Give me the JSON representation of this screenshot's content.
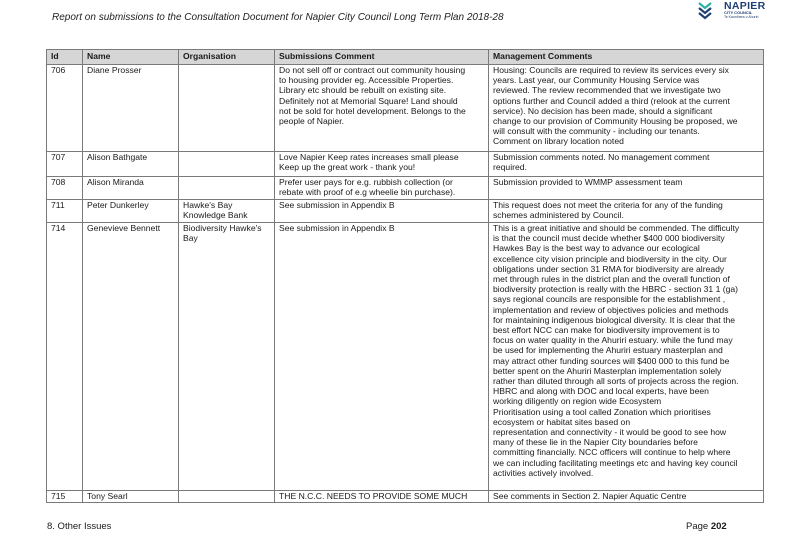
{
  "header": {
    "title": "Report on submissions to the Consultation Document for Napier City Council Long Term Plan 2018-28",
    "logo": {
      "word": "NAPIER",
      "sub": "CITY COUNCIL",
      "tagline": "Te Kaunihera o Ahuriri",
      "icon": "waves-logo-icon",
      "color": "#1f3e73",
      "accent": "#2bb3a3"
    }
  },
  "table": {
    "columns": [
      "Id",
      "Name",
      "Organisation",
      "Submissions Comment",
      "Management Comments"
    ],
    "rows": [
      {
        "id": "706",
        "name": "Diane Prosser",
        "org": "",
        "submission": "Do not sell off or contract out community housing\nto housing provider eg. Accessible Properties.\nLibrary etc should be rebuilt on existing site.\nDefinitely not at Memorial Square! Land should\nnot be sold for hotel development.  Belongs to the\npeople of Napier.",
        "management": "Housing: Councils are required to review its services every six\nyears.  Last year, our Community Housing Service was\nreviewed.  The review recommended that we investigate two\noptions further and Council added a third (relook at the current\nservice). No decision has been made, should a significant\nchange to our provision of Community Housing be proposed, we\nwill consult with the community - including our tenants.\nComment on library location noted"
      },
      {
        "id": "707",
        "name": "Alison Bathgate",
        "org": "",
        "submission": "Love Napier Keep rates increases small please\nKeep up the great work - thank you!",
        "management": "Submission comments noted. No management comment\nrequired."
      },
      {
        "id": "708",
        "name": "Alison Miranda",
        "org": "",
        "submission": "Prefer user pays for e.g. rubbish collection (or\nrebate with proof of e.g wheelie bin purchase).",
        "management": "Submission provided to WMMP assessment team"
      },
      {
        "id": "711",
        "name": "Peter Dunkerley",
        "org": "Hawke's Bay\nKnowledge Bank",
        "submission": " See submission in Appendix B",
        "management": "This request does not meet the criteria for any of the funding\nschemes administered by Council."
      },
      {
        "id": "714",
        "name": "Genevieve Bennett",
        "org": "Biodiversity Hawke's\nBay",
        "submission": " See submission in Appendix B",
        "management": "This is a great initiative and should be commended. The difficulty\nis that the council must decide whether $400 000 biodiversity\nHawkes Bay is the best way to advance our ecological\nexcellence city vision principle and biodiversity in the city. Our\nobligations under section 31 RMA for biodiversity are already\nmet through rules in the district plan and the overall function of\nbiodiversity protection is really with the HBRC - section 31 1 (ga)\nsays regional councils are responsible for the establishment ,\nimplementation and review of objectives policies and methods\nfor maintaining indigenous biological diversity.  It is clear that the\nbest effort NCC can make for biodiversity improvement is to\nfocus on water quality in the Ahuriri  estuary. while the fund may\nbe used for implementing the Ahuriri estuary masterplan and\nmay attract other funding sources will $400 000 to this fund be\nbetter spent on the Ahuriri Masterplan implementation solely\nrather than diluted through all sorts of projects across the region.\nHBRC and along with DOC and local experts, have been\nworking diligently on region wide Ecosystem\nPrioritisation using a tool called Zonation which prioritises\necosystem or habitat sites based on\nrepresentation and connectivity - it would be good to see how\nmany of these lie in the Napier City boundaries before\ncommitting financially. NCC officers will continue to help where\nwe can including facilitating meetings etc and having key council\nactivities actively involved."
      },
      {
        "id": "715",
        "name": "Tony Searl",
        "org": "",
        "submission": "THE N.C.C. NEEDS TO PROVIDE SOME MUCH",
        "management": "See comments in Section 2. Napier Aquatic Centre"
      }
    ]
  },
  "footer": {
    "section": "8. Other Issues",
    "page_label": "Page",
    "page_number": "202"
  }
}
